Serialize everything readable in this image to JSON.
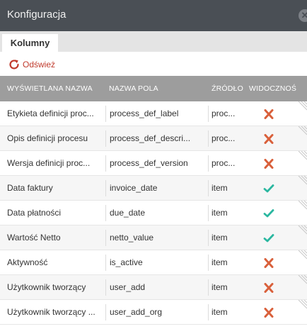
{
  "window": {
    "title": "Konfiguracja"
  },
  "tabs": [
    {
      "label": "Kolumny"
    }
  ],
  "toolbar": {
    "refresh_label": "Odśwież"
  },
  "table": {
    "headers": {
      "display_name": "WYŚWIETLANA NAZWA",
      "field_name": "NAZWA POLA",
      "source": "ŹRÓDŁO",
      "visibility": "WIDOCZNOŚ"
    },
    "rows": [
      {
        "display_name": "Etykieta definicji proc...",
        "field_name": "process_def_label",
        "source": "proc...",
        "visible": false
      },
      {
        "display_name": "Opis definicji procesu",
        "field_name": "process_def_descri...",
        "source": "proc...",
        "visible": false
      },
      {
        "display_name": "Wersja definicji proc...",
        "field_name": "process_def_version",
        "source": "proc...",
        "visible": false
      },
      {
        "display_name": "Data faktury",
        "field_name": "invoice_date",
        "source": "item",
        "visible": true
      },
      {
        "display_name": "Data płatności",
        "field_name": "due_date",
        "source": "item",
        "visible": true
      },
      {
        "display_name": "Wartość Netto",
        "field_name": "netto_value",
        "source": "item",
        "visible": true
      },
      {
        "display_name": "Aktywność",
        "field_name": "is_active",
        "source": "item",
        "visible": false
      },
      {
        "display_name": "Użytkownik tworzący",
        "field_name": "user_add",
        "source": "item",
        "visible": false
      },
      {
        "display_name": "Użytkownik tworzący ...",
        "field_name": "user_add_org",
        "source": "item",
        "visible": false
      }
    ]
  },
  "colors": {
    "titlebar": "#4a4f55",
    "header": "#9d9d9d",
    "accent_red": "#c0392b",
    "cross": "#d9603b",
    "check": "#2ab7a0"
  },
  "icons": {
    "refresh": "refresh-icon",
    "close": "close-icon",
    "visible_true": "check-icon",
    "visible_false": "cross-icon"
  }
}
